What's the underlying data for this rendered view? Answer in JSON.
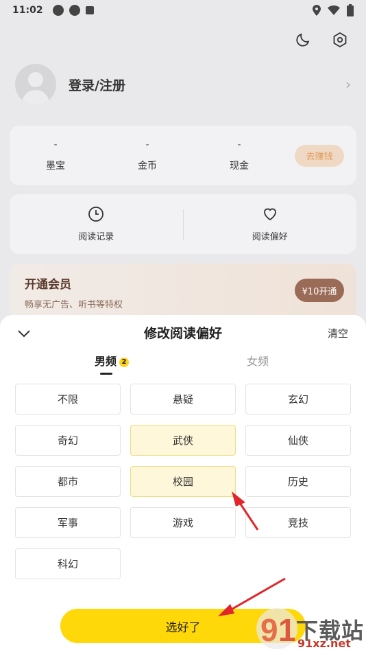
{
  "status_bar": {
    "time": "11:02"
  },
  "profile": {
    "login_label": "登录/注册"
  },
  "wallet": {
    "stats": [
      {
        "value": "-",
        "label": "墨宝"
      },
      {
        "value": "-",
        "label": "金币"
      },
      {
        "value": "-",
        "label": "现金"
      }
    ],
    "earn_label": "去赚钱"
  },
  "records": {
    "history_label": "阅读记录",
    "preference_label": "阅读偏好"
  },
  "vip": {
    "title": "开通会员",
    "subtitle": "畅享无广告、听书等特权",
    "button_label": "¥10开通"
  },
  "sheet": {
    "title": "修改阅读偏好",
    "clear_label": "清空",
    "tabs": [
      {
        "label": "男频",
        "badge": "2"
      },
      {
        "label": "女频"
      }
    ],
    "options": [
      {
        "label": "不限",
        "selected": false
      },
      {
        "label": "悬疑",
        "selected": false
      },
      {
        "label": "玄幻",
        "selected": false
      },
      {
        "label": "奇幻",
        "selected": false
      },
      {
        "label": "武侠",
        "selected": true
      },
      {
        "label": "仙侠",
        "selected": false
      },
      {
        "label": "都市",
        "selected": false
      },
      {
        "label": "校园",
        "selected": true
      },
      {
        "label": "历史",
        "selected": false
      },
      {
        "label": "军事",
        "selected": false
      },
      {
        "label": "游戏",
        "selected": false
      },
      {
        "label": "竞技",
        "selected": false
      },
      {
        "label": "科幻",
        "selected": false
      }
    ],
    "done_label": "选好了"
  },
  "watermark": {
    "brand": "下载站",
    "url": "91xz.net"
  },
  "colors": {
    "accent": "#ffd80a",
    "selected_bg": "#fff7d9",
    "annotation_arrow": "#e0262b"
  }
}
